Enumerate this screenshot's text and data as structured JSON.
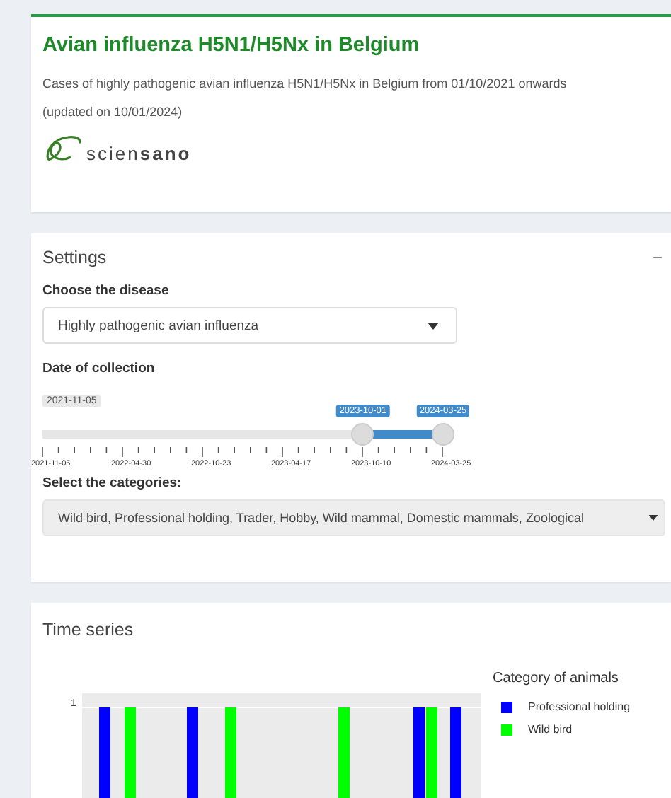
{
  "header": {
    "title": "Avian influenza H5N1/H5Nx in Belgium",
    "description": "Cases of highly pathogenic avian influenza H5N1/H5Nx in Belgium from 01/10/2021 onwards",
    "updated": "(updated on 10/01/2024)",
    "logo_text": "scien**sano**"
  },
  "settings": {
    "title": "Settings",
    "collapse": "−",
    "disease": {
      "label": "Choose the disease",
      "value": "Highly pathogenic avian influenza"
    },
    "date": {
      "label": "Date of collection",
      "min": "2021-11-05",
      "handles": [
        {
          "label": "2023-10-01"
        },
        {
          "label": "2024-03-25"
        }
      ],
      "tick_labels": [
        "2021-11-05",
        "2022-04-30",
        "2022-10-23",
        "2023-04-17",
        "2023-10-10",
        "2024-03-25"
      ]
    },
    "categories": {
      "label": "Select the categories:",
      "value": "Wild bird, Professional holding, Trader, Hobby, Wild mammal, Domestic mammals, Zoological"
    }
  },
  "time_series": {
    "title": "Time series",
    "y_tick": "1",
    "legend": {
      "title": "Category of animals",
      "items": [
        {
          "name": "Professional holding",
          "color": "#0000ff"
        },
        {
          "name": "Wild bird",
          "color": "#00ff00"
        }
      ]
    }
  }
}
